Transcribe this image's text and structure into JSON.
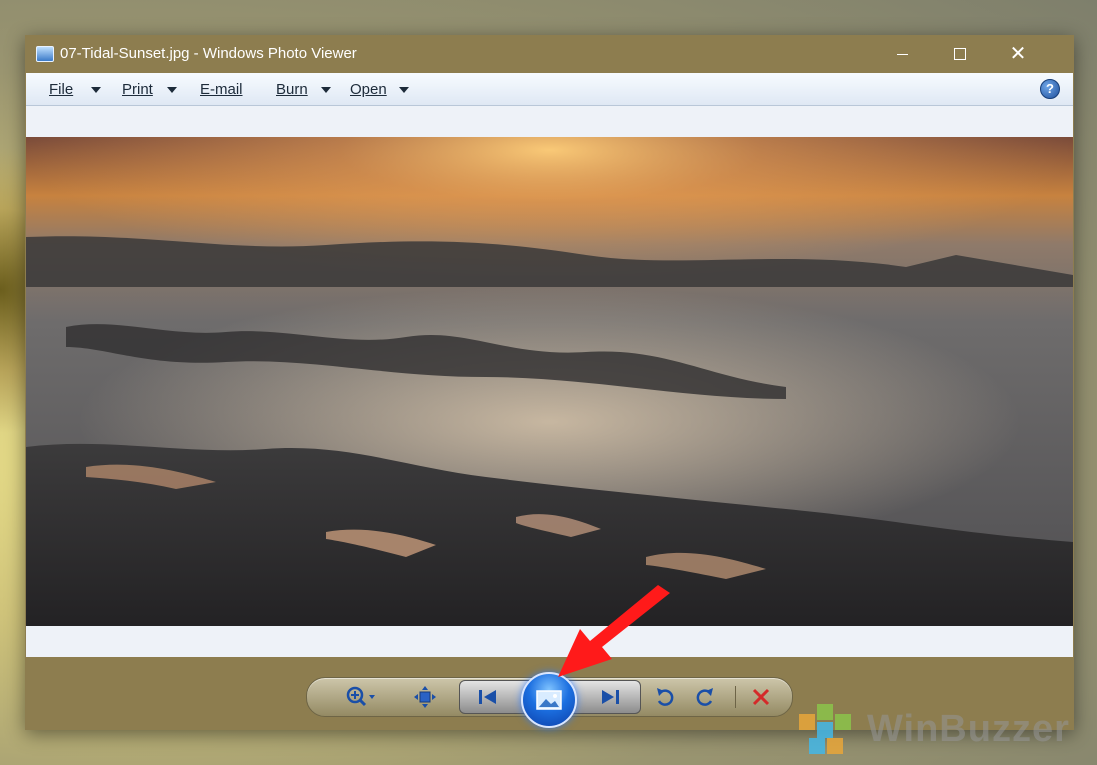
{
  "window": {
    "title": "07-Tidal-Sunset.jpg - Windows Photo Viewer"
  },
  "menu": {
    "items": [
      {
        "label": "File",
        "has_dropdown": true
      },
      {
        "label": "Print",
        "has_dropdown": true
      },
      {
        "label": "E-mail",
        "has_dropdown": false
      },
      {
        "label": "Burn",
        "has_dropdown": true
      },
      {
        "label": "Open",
        "has_dropdown": true
      }
    ],
    "help_label": "?"
  },
  "photo": {
    "subject": "tidal sunset seascape"
  },
  "toolbar": {
    "buttons": [
      {
        "name": "zoom-button",
        "icon": "zoom-icon"
      },
      {
        "name": "actual-size-button",
        "icon": "actual-size-icon"
      },
      {
        "name": "previous-button",
        "icon": "previous-icon"
      },
      {
        "name": "slideshow-button",
        "icon": "slideshow-icon"
      },
      {
        "name": "next-button",
        "icon": "next-icon"
      },
      {
        "name": "rotate-counterclockwise-button",
        "icon": "rotate-left-icon"
      },
      {
        "name": "rotate-clockwise-button",
        "icon": "rotate-right-icon"
      },
      {
        "name": "delete-button",
        "icon": "delete-icon"
      }
    ]
  },
  "watermark": {
    "text": "WinBuzzer"
  },
  "colors": {
    "titlebar": "#8d7d4f",
    "menubar": "#e8eef6",
    "accent_blue": "#1c6fe0",
    "delete_red": "#d42a2a",
    "annotation_arrow": "#ff1a1a"
  }
}
